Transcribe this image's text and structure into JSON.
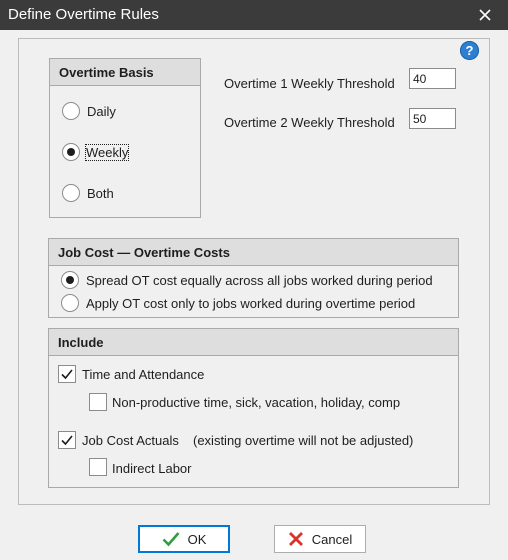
{
  "window": {
    "title": "Define Overtime Rules",
    "close_icon": "close-icon"
  },
  "help": {
    "glyph": "?",
    "icon": "help-icon"
  },
  "overtime_basis": {
    "heading": "Overtime Basis",
    "options": [
      {
        "label": "Daily",
        "checked": false
      },
      {
        "label": "Weekly",
        "checked": true
      },
      {
        "label": "Both",
        "checked": false
      }
    ]
  },
  "thresholds": {
    "ot1_label": "Overtime 1 Weekly Threshold",
    "ot1_value": "40",
    "ot2_label": "Overtime 2 Weekly Threshold",
    "ot2_value": "50"
  },
  "job_cost": {
    "heading": "Job Cost — Overtime Costs",
    "options": [
      {
        "label": "Spread OT cost equally across all jobs worked during period",
        "checked": true
      },
      {
        "label": "Apply OT cost only to jobs worked during overtime period",
        "checked": false
      }
    ]
  },
  "include": {
    "heading": "Include",
    "time_attendance": {
      "label": "Time and Attendance",
      "checked": true
    },
    "non_productive": {
      "label": "Non-productive time, sick, vacation, holiday, comp",
      "checked": false
    },
    "job_cost_actuals": {
      "label": "Job Cost Actuals",
      "note": "(existing overtime will not be adjusted)",
      "checked": true
    },
    "indirect_labor": {
      "label": "Indirect Labor",
      "checked": false
    }
  },
  "buttons": {
    "ok_label": "OK",
    "cancel_label": "Cancel"
  },
  "colors": {
    "titlebar": "#3b3b3b",
    "ok_check": "#2e9e3e",
    "cancel_x": "#d9342b",
    "help": "#2f7fd0"
  }
}
